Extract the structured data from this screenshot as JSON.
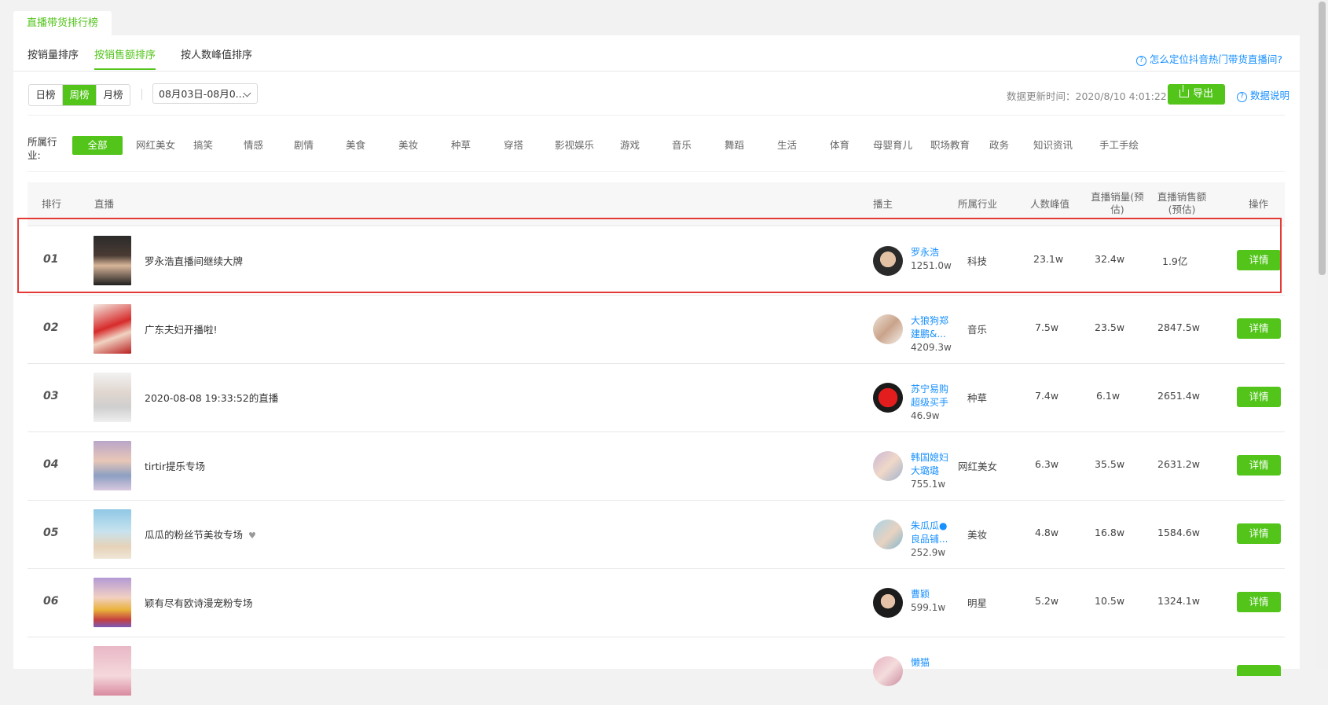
{
  "top_tab": "直播带货排行榜",
  "sort_tabs": [
    "按销量排序",
    "按销售额排序",
    "按人数峰值排序"
  ],
  "help_link": "怎么定位抖音热门带货直播间?",
  "period": [
    "日榜",
    "周榜",
    "月榜"
  ],
  "date_range": "08月03日-08月0...",
  "update_time": "数据更新时间：2020/8/10 4:01:22",
  "export": "导出",
  "data_explain": "数据说明",
  "industry_label": "所属行业:",
  "industries": [
    "全部",
    "网红美女",
    "搞笑",
    "情感",
    "剧情",
    "美食",
    "美妆",
    "种草",
    "穿搭",
    "影视娱乐",
    "游戏",
    "音乐",
    "舞蹈",
    "生活",
    "体育",
    "母婴育儿",
    "职场教育",
    "政务",
    "知识资讯",
    "手工手绘"
  ],
  "headers": {
    "rank": "排行",
    "live": "直播",
    "anchor": "播主",
    "industry": "所属行业",
    "peak": "人数峰值",
    "sales_l1": "直播销量(预",
    "sales_l2": "估)",
    "revenue_l1": "直播销售额",
    "revenue_l2": "(预估)",
    "action": "操作"
  },
  "detail_label": "详情",
  "rows": [
    {
      "rank": "01",
      "title": "罗永浩直播间继续大牌",
      "name": "罗永浩",
      "name2": "",
      "fans": "1251.0w",
      "industry": "科技",
      "peak": "23.1w",
      "sales": "32.4w",
      "revenue": "1.9亿"
    },
    {
      "rank": "02",
      "title": "广东夫妇开播啦!",
      "name": "大狼狗郑",
      "name2": "建鹏&...",
      "fans": "4209.3w",
      "industry": "音乐",
      "peak": "7.5w",
      "sales": "23.5w",
      "revenue": "2847.5w"
    },
    {
      "rank": "03",
      "title": "2020-08-08 19:33:52的直播",
      "name": "苏宁易购",
      "name2": "超级买手",
      "fans": "46.9w",
      "industry": "种草",
      "peak": "7.4w",
      "sales": "6.1w",
      "revenue": "2651.4w"
    },
    {
      "rank": "04",
      "title": "tirtir提乐专场",
      "name": "韩国媳妇",
      "name2": "大璐璐",
      "fans": "755.1w",
      "industry": "网红美女",
      "peak": "6.3w",
      "sales": "35.5w",
      "revenue": "2631.2w"
    },
    {
      "rank": "05",
      "title": "瓜瓜的粉丝节美妆专场",
      "name": "朱瓜瓜●",
      "name2": "良品铺...",
      "fans": "252.9w",
      "industry": "美妆",
      "peak": "4.8w",
      "sales": "16.8w",
      "revenue": "1584.6w"
    },
    {
      "rank": "06",
      "title": "颖有尽有欧诗漫宠粉专场",
      "name": "曹颖",
      "name2": "",
      "fans": "599.1w",
      "industry": "明星",
      "peak": "5.2w",
      "sales": "10.5w",
      "revenue": "1324.1w"
    },
    {
      "rank": "",
      "title": "",
      "name": "懒猫",
      "name2": "",
      "fans": "",
      "industry": "",
      "peak": "",
      "sales": "",
      "revenue": ""
    }
  ],
  "colors": {
    "accent": "#52c41a",
    "link": "#1890ff",
    "highlight": "#e53935"
  }
}
